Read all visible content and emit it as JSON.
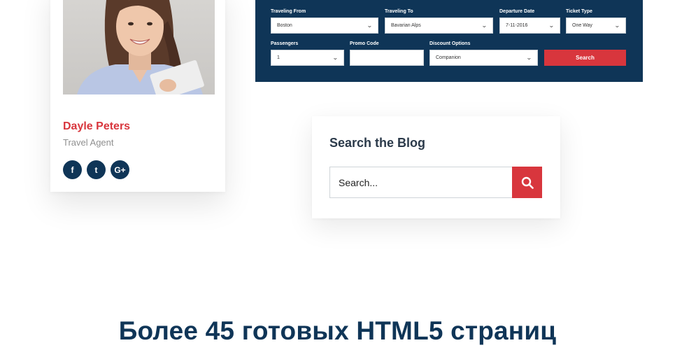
{
  "profile": {
    "name": "Dayle Peters",
    "role": "Travel Agent",
    "socials": [
      {
        "icon": "facebook-icon",
        "glyph": "f"
      },
      {
        "icon": "twitter-icon",
        "glyph": "t"
      },
      {
        "icon": "google-plus-icon",
        "glyph": "G+"
      }
    ]
  },
  "booking": {
    "fields": {
      "from": {
        "label": "Traveling From",
        "value": "Boston"
      },
      "to": {
        "label": "Traveling To",
        "value": "Bavarian Alps"
      },
      "departure": {
        "label": "Departure Date",
        "value": "7-11-2016"
      },
      "ticket": {
        "label": "Ticket Type",
        "value": "One Way"
      },
      "passengers": {
        "label": "Passengers",
        "value": "1"
      },
      "promo": {
        "label": "Promo Code",
        "value": ""
      },
      "discount": {
        "label": "Discount Options",
        "value": "Companion"
      }
    },
    "search_label": "Search"
  },
  "blog": {
    "title": "Search the Blog",
    "placeholder": "Search...",
    "search_icon": "search-icon"
  },
  "heading": "Более 45 готовых HTML5 страниц",
  "colors": {
    "navy": "#0f3557",
    "accent_red": "#d8363d",
    "muted_text": "#8f8f8f"
  }
}
